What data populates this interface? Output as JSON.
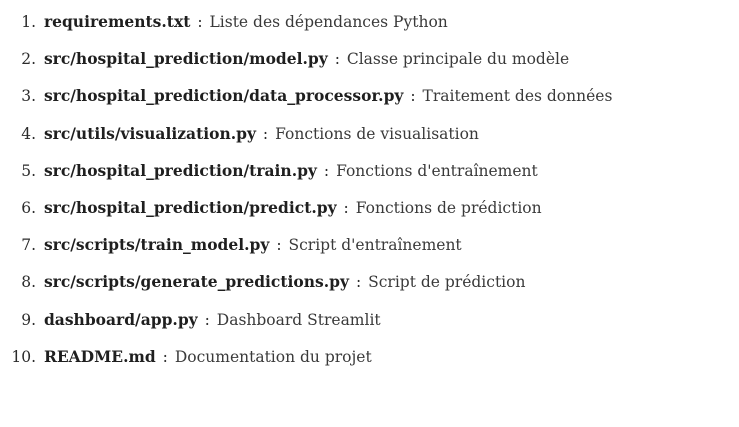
{
  "files": [
    {
      "number": "1.",
      "name": "requirements.txt",
      "separator": ":",
      "description": "Liste des dépendances Python"
    },
    {
      "number": "2.",
      "name": "src/hospital_prediction/model.py",
      "separator": ":",
      "description": "Classe principale du modèle"
    },
    {
      "number": "3.",
      "name": "src/hospital_prediction/data_processor.py",
      "separator": ":",
      "description": "Traitement des données"
    },
    {
      "number": "4.",
      "name": "src/utils/visualization.py",
      "separator": ":",
      "description": "Fonctions de visualisation"
    },
    {
      "number": "5.",
      "name": "src/hospital_prediction/train.py",
      "separator": ":",
      "description": "Fonctions d'entraînement"
    },
    {
      "number": "6.",
      "name": "src/hospital_prediction/predict.py",
      "separator": ":",
      "description": "Fonctions de prédiction"
    },
    {
      "number": "7.",
      "name": "src/scripts/train_model.py",
      "separator": ":",
      "description": "Script d'entraînement"
    },
    {
      "number": "8.",
      "name": "src/scripts/generate_predictions.py",
      "separator": ":",
      "description": "Script de prédiction"
    },
    {
      "number": "9.",
      "name": "dashboard/app.py",
      "separator": ":",
      "description": "Dashboard Streamlit"
    },
    {
      "number": "10.",
      "name": "README.md",
      "separator": ":",
      "description": "Documentation du projet"
    }
  ]
}
